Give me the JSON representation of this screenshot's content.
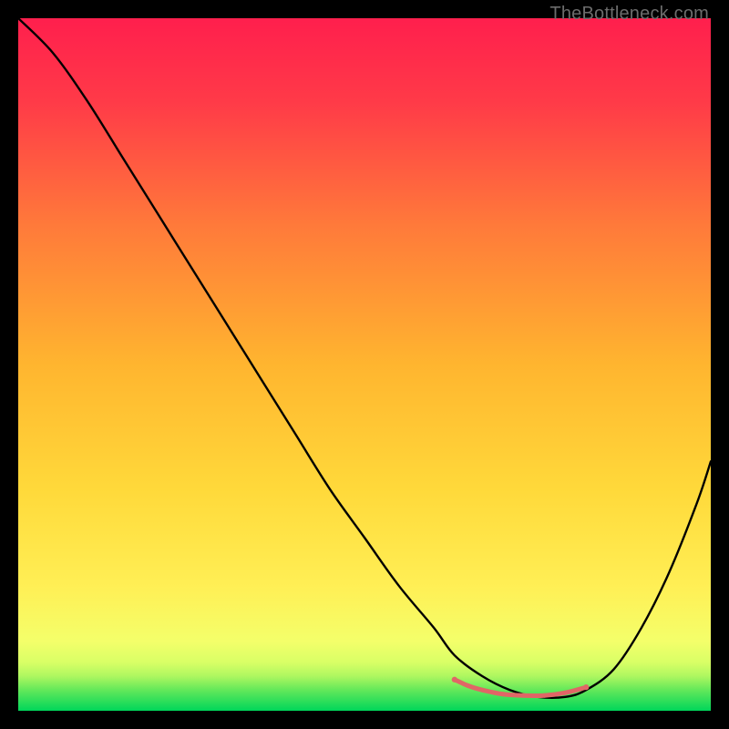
{
  "watermark": "TheBottleneck.com",
  "chart_data": {
    "type": "line",
    "title": "",
    "xlabel": "",
    "ylabel": "",
    "xlim": [
      0,
      100
    ],
    "ylim": [
      0,
      100
    ],
    "grid": false,
    "legend": false,
    "gradient_background": {
      "top_color": "#ff1f4d",
      "mid_color": "#ffd400",
      "bottom_green_band_start": "#f7ff66",
      "bottom_green_band_end": "#00d65a"
    },
    "series": [
      {
        "name": "bottleneck-curve",
        "color": "#000000",
        "x": [
          0,
          5,
          10,
          15,
          20,
          25,
          30,
          35,
          40,
          45,
          50,
          55,
          60,
          63,
          67,
          71,
          75,
          79,
          82,
          86,
          90,
          94,
          98,
          100
        ],
        "y": [
          100,
          95,
          88,
          80,
          72,
          64,
          56,
          48,
          40,
          32,
          25,
          18,
          12,
          8,
          5,
          3,
          2,
          2,
          3,
          6,
          12,
          20,
          30,
          36
        ]
      },
      {
        "name": "optimal-range-marker",
        "color": "#e06666",
        "thickness": 5,
        "x": [
          63,
          65,
          67,
          70,
          73,
          76,
          79,
          82
        ],
        "y": [
          4.5,
          3.6,
          3.0,
          2.4,
          2.2,
          2.2,
          2.6,
          3.4
        ]
      }
    ],
    "annotations": []
  }
}
